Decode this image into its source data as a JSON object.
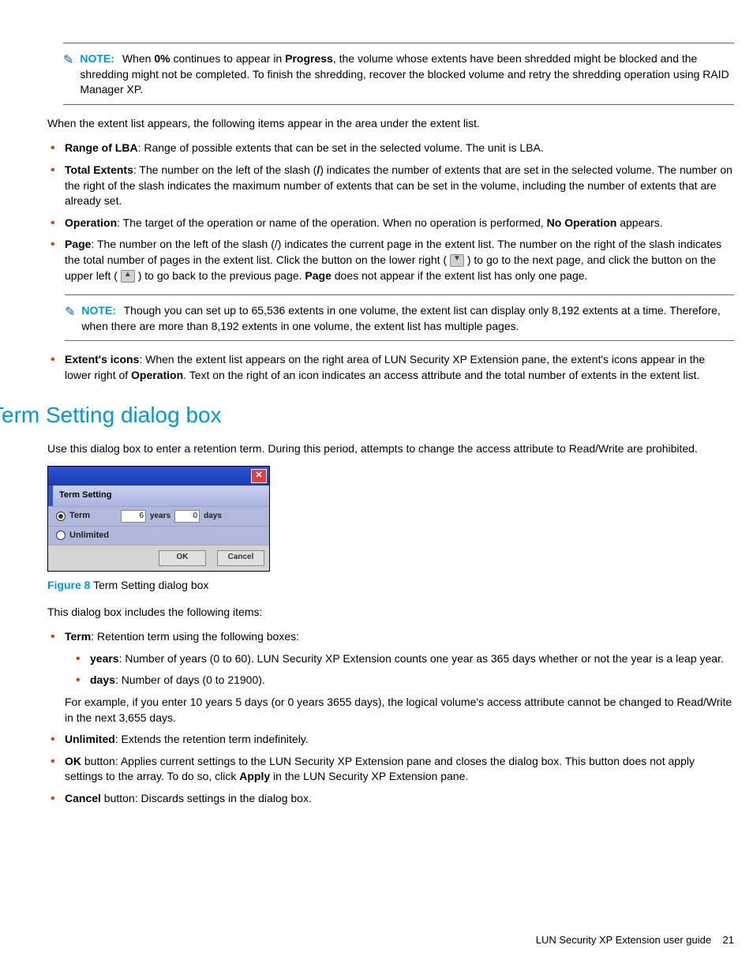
{
  "note1": {
    "label": "NOTE:",
    "text_a": "When ",
    "bold1": "0%",
    "text_b": " continues to appear in ",
    "bold2": "Progress",
    "text_c": ", the volume whose extents have been shredded might be blocked and the shredding might not be completed. To finish the shredding, recover the blocked volume and retry the shredding operation using RAID Manager XP."
  },
  "para_after_note1": "When the extent list appears, the following items appear in the area under the extent list.",
  "list1": {
    "range": {
      "label": "Range of LBA",
      "text": ": Range of possible extents that can be set in the selected volume. The unit is LBA."
    },
    "total": {
      "label": "Total Extents",
      "text_a": ": The number on the left of the slash (",
      "slash": "/",
      "text_b": ") indicates the number of extents that are set in the selected volume. The number on the right of the slash indicates the maximum number of extents that can be set in the volume, including the number of extents that are already set."
    },
    "operation": {
      "label": "Operation",
      "text_a": ": The target of the operation or name of the operation. When no operation is performed, ",
      "bold": "No Operation",
      "text_b": " appears."
    },
    "page": {
      "label": "Page",
      "text_a": ": The number on the left of the slash (/) indicates the current page in the extent list. The number on the right of the slash indicates the total number of pages in the extent list. Click the button on the lower right ( ",
      "text_b": " ) to go to the next page, and click the button on the upper left ( ",
      "text_c": " ) to go back to the previous page. ",
      "bold": "Page",
      "text_d": " does not appear if the extent list has only one page."
    },
    "extent_icons": {
      "label": "Extent's icons",
      "text_a": ": When the extent list appears on the right area of LUN Security XP Extension pane, the extent's icons appear in the lower right of ",
      "bold": "Operation",
      "text_b": ". Text on the right of an icon indicates an access attribute and the total number of extents in the extent list."
    }
  },
  "note2": {
    "label": "NOTE:",
    "text": "Though you can set up to 65,536 extents in one volume, the extent list can display only 8,192 extents at a time. Therefore, when there are more than 8,192 extents in one volume, the extent list has multiple pages."
  },
  "heading": "Term Setting dialog box",
  "heading_para": "Use this dialog box to enter a retention term. During this period, attempts to change the access attribute to Read/Write are prohibited.",
  "dialog": {
    "header": "Term Setting",
    "term_label": "Term",
    "years_value": "6",
    "years_unit": "years",
    "days_value": "0",
    "days_unit": "days",
    "unlimited_label": "Unlimited",
    "ok": "OK",
    "cancel": "Cancel"
  },
  "figure": {
    "label": "Figure 8",
    "caption": " Term Setting dialog box"
  },
  "para_after_figure": "This dialog box includes the following items:",
  "list2": {
    "term": {
      "label": "Term",
      "text": ": Retention term using the following boxes:"
    },
    "years": {
      "label": "years",
      "text": ": Number of years (0 to 60). LUN Security XP Extension counts one year as 365 days whether or not the year is a leap year."
    },
    "days": {
      "label": "days",
      "text": ": Number of days (0 to 21900)."
    },
    "example": "For example, if you enter 10 years 5 days (or 0 years 3655 days), the logical volume's access attribute cannot be changed to Read/Write in the next 3,655 days.",
    "unlimited": {
      "label": "Unlimited",
      "text": ": Extends the retention term indefinitely."
    },
    "ok": {
      "label": "OK",
      "text_a": " button: Applies current settings to the LUN Security XP Extension pane and closes the dialog box. This button does not apply settings to the array. To do so, click ",
      "bold": "Apply",
      "text_b": " in the LUN Security XP Extension pane."
    },
    "cancel": {
      "label": "Cancel",
      "text": " button: Discards settings in the dialog box."
    }
  },
  "footer": {
    "text": "LUN Security XP Extension user guide",
    "page": "21"
  }
}
